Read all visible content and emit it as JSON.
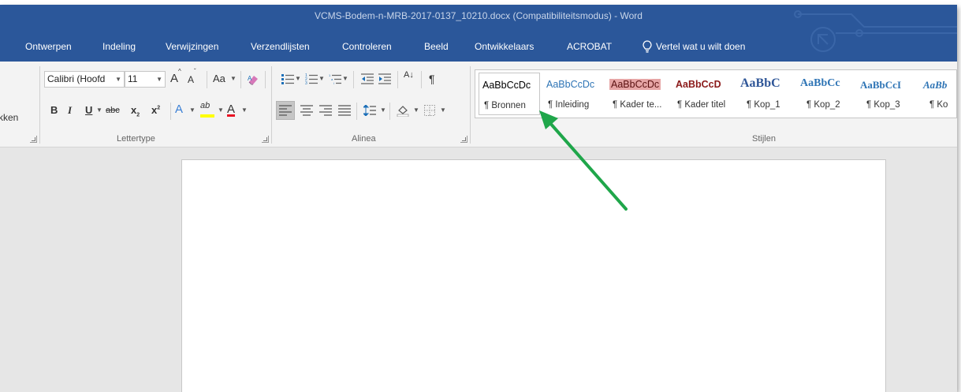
{
  "window": {
    "title": "VCMS-Bodem-n-MRB-2017-0137_10210.docx (Compatibiliteitsmodus) - Word"
  },
  "tabs": [
    {
      "label": "Ontwerpen"
    },
    {
      "label": "Indeling"
    },
    {
      "label": "Verwijzingen"
    },
    {
      "label": "Verzendlijsten"
    },
    {
      "label": "Controleren"
    },
    {
      "label": "Beeld"
    },
    {
      "label": "Ontwikkelaars"
    },
    {
      "label": "ACROBAT"
    }
  ],
  "tell_me": {
    "label": "Vertel wat u wilt doen"
  },
  "clipboard": {
    "cut_label": "kken"
  },
  "font": {
    "family": "Calibri (Hoofd",
    "size": "11",
    "grow_label": "A",
    "shrink_label": "A",
    "case_label": "Aa",
    "bold_label": "B",
    "italic_label": "I",
    "underline_label": "U",
    "strike_label": "abc",
    "subscript_label": "x",
    "superscript_label": "x",
    "effects_label": "A",
    "highlight_label": "ab",
    "color_label": "A",
    "highlight_color": "#ffff00",
    "font_color": "#e81123"
  },
  "paragraph": {
    "sort_label": "A↓",
    "pilcrow_label": "¶"
  },
  "groups": {
    "font": "Lettertype",
    "paragraph": "Alinea",
    "styles": "Stijlen"
  },
  "styles": [
    {
      "sample": "AaBbCcDc",
      "name": "¶ Bronnen",
      "color": "#000000"
    },
    {
      "sample": "AaBbCcDc",
      "name": "¶ Inleiding",
      "color": "#2e74b5"
    },
    {
      "sample": "AaBbCcDc",
      "name": "¶ Kader te...",
      "color": "#7f1f1f"
    },
    {
      "sample": "AaBbCcD",
      "name": "¶ Kader titel",
      "color": "#8b1a1a"
    },
    {
      "sample": "AaBbC",
      "name": "¶ Kop_1",
      "color": "#2e5597"
    },
    {
      "sample": "AaBbCc",
      "name": "¶ Kop_2",
      "color": "#2e74b5"
    },
    {
      "sample": "AaBbCcI",
      "name": "¶ Kop_3",
      "color": "#2e74b5"
    },
    {
      "sample": "AaBb",
      "name": "¶ Ko",
      "color": "#2e74b5"
    }
  ],
  "colors": {
    "accent": "#2b579a",
    "annotation_arrow": "#1fa64a",
    "kader_te_background": "#e6a5a5"
  },
  "icons": [
    "format-painter-icon",
    "bullets-icon",
    "numbering-icon",
    "multilevel-list-icon",
    "decrease-indent-icon",
    "increase-indent-icon",
    "sort-icon",
    "pilcrow-icon",
    "align-left-icon",
    "align-center-icon",
    "align-right-icon",
    "justify-icon",
    "line-spacing-icon",
    "shading-icon",
    "borders-icon",
    "lightbulb-icon",
    "annotation-arrow"
  ]
}
